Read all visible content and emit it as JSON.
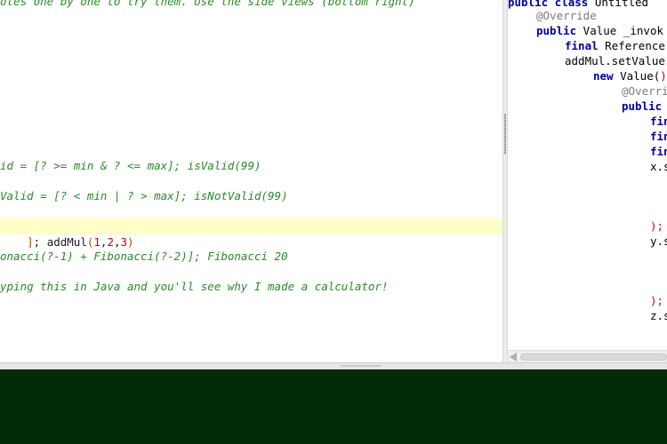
{
  "editor": {
    "lines": [
      "otes one by one to try them. Use the side views (bottom right)",
      "id = [? >= min & ? <= max]; isValid(99)",
      "Valid = [? < min | ? > max]; isNotValid(99)",
      "]",
      "; addMul",
      "(",
      "1",
      ",",
      "2",
      ",",
      "3",
      ")",
      "onacci(?-1) + Fibonacci(?-2)]; Fibonacci 20",
      "yping this in Java and you'll see why I made a calculator!"
    ]
  },
  "code": {
    "l0_kw": "public class",
    "l0_rest": " Untitled ",
    "l1": "@Override",
    "l2_kw": "public",
    "l2_rest": " Value _invok",
    "l3_kw": "final",
    "l3_rest": " Reference",
    "l4": "addMul.setValue",
    "l5_kw": "new",
    "l5_rest": " Value(",
    "l5_paren": ")",
    "l6": "@Overri",
    "l7": "public",
    "l8": "fin",
    "l9": "fin",
    "l10": "fin",
    "l11": "x.s",
    "l12": ");",
    "l13": "y.s",
    "l14": ");",
    "l15": "z.s"
  },
  "colors": {
    "comment": "#2a8a2a",
    "current_line": "#ffffc8",
    "bottom_panel": "#032b06",
    "keyword": "#0000a8"
  }
}
